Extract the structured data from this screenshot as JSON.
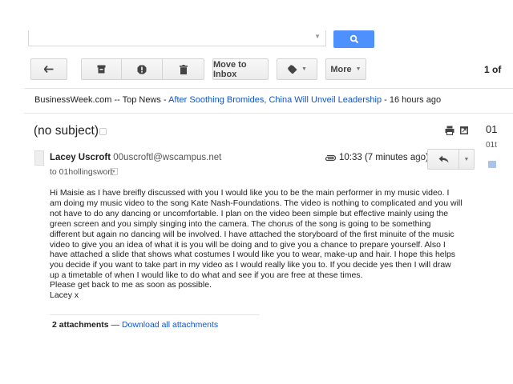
{
  "toolbar": {
    "move_to_inbox": "Move to Inbox",
    "more": "More",
    "page_indicator": "1 of"
  },
  "news": {
    "source": "BusinessWeek.com -- Top News -",
    "headline": "After Soothing Bromides, China Will Unveil Leadership",
    "age": "- 16 hours ago"
  },
  "message": {
    "subject": "(no subject)",
    "sender_name": "Lacey Uscroft",
    "sender_email": "00uscroftl@wscampus.net",
    "to": "to 01hollingswort",
    "time": "10:33 (7 minutes ago)",
    "body": "Hi Maisie as I have breifly discussed with you I would like you to be the main performer in my music video. I am doing my music video to the song Kate Nash-Foundations. The video is nothing to complicated and you will not have to do any dancing or uncomfortable. I plan on the video been simple but effective mainly using the green screen and you simply singing into the camera. The chorus of the song is going to be something different but again no dancing will be involved. I have attached the storyboard of the first minuite of the music video to give you an idea of what it is you will be doing and to give you a chance to prepare yourself. Also I have attached a slide that shows what costumes I would like you to wear, make-up and hair. I hope this helps you decide if you want to take part in my video as I would really like you to. If you decide yes then I will draw up a timetable of when I would like to do what and see if you are free at these times.",
    "closing": "Please get back to me as soon as possible.",
    "signature": "Lacey x"
  },
  "attachments": {
    "count_label": "2 attachments",
    "separator": "—",
    "download_all": "Download all attachments"
  },
  "side_panel": {
    "line1": "01",
    "line2": "01t"
  },
  "icons": {
    "search": "search-icon",
    "back": "back-arrow-icon",
    "archive": "archive-icon",
    "spam": "report-spam-icon",
    "delete": "trash-icon",
    "labels": "label-icon",
    "print": "print-icon",
    "new_window": "new-window-icon",
    "attachment": "paperclip-icon",
    "star": "star-icon",
    "reply": "reply-icon",
    "more": "chevron-down-icon"
  },
  "colors": {
    "link": "#1155cc",
    "search_button": "#4d90fe"
  }
}
